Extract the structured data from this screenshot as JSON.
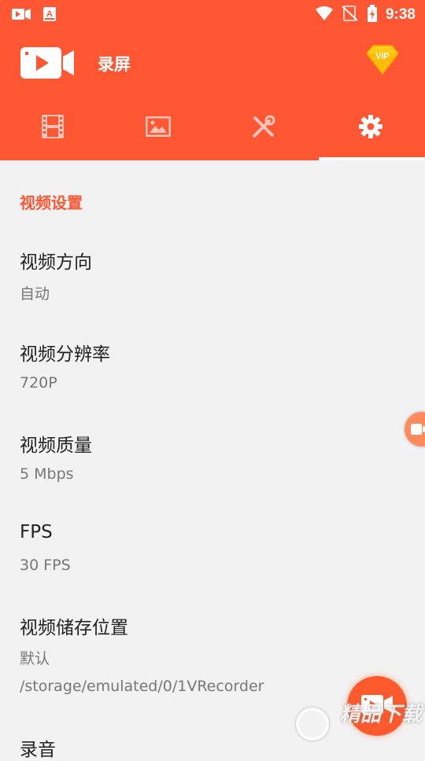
{
  "status_bar": {
    "time": "9:38"
  },
  "app": {
    "title": "录屏",
    "vip_label": "VIP"
  },
  "tabs": [
    {
      "icon": "film-icon",
      "active": false
    },
    {
      "icon": "image-icon",
      "active": false
    },
    {
      "icon": "tools-icon",
      "active": false
    },
    {
      "icon": "gear-icon",
      "active": true
    }
  ],
  "settings": {
    "section_title": "视频设置",
    "orientation": {
      "title": "视频方向",
      "value": "自动"
    },
    "resolution": {
      "title": "视频分辨率",
      "value": "720P"
    },
    "quality": {
      "title": "视频质量",
      "value": "5 Mbps"
    },
    "fps": {
      "title": "FPS",
      "value": "30 FPS"
    },
    "storage": {
      "title": "视频储存位置",
      "value": "默认",
      "path": "/storage/emulated/0/1VRecorder"
    },
    "audio": {
      "title": "录音"
    }
  },
  "watermark": {
    "text": "精品下载"
  },
  "colors": {
    "primary": "#ff5733",
    "background": "#f2f2f2"
  }
}
